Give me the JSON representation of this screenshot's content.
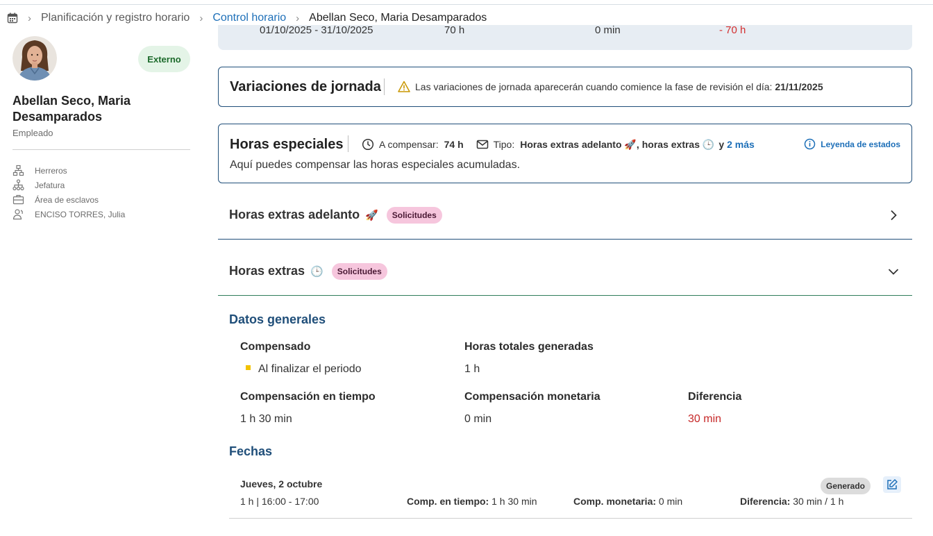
{
  "breadcrumb": {
    "items": [
      "Planificación y registro horario",
      "Control horario",
      "Abellan Seco, Maria Desamparados"
    ]
  },
  "employee": {
    "badge": "Externo",
    "name": "Abellan Seco, Maria Desamparados",
    "role": "Empleado",
    "details": [
      {
        "icon": "org-chart-icon",
        "text": "Herreros"
      },
      {
        "icon": "hierarchy-icon",
        "text": "Jefatura"
      },
      {
        "icon": "briefcase-icon",
        "text": "Área de esclavos"
      },
      {
        "icon": "person-manager-icon",
        "text": "ENCISO TORRES, Julia"
      }
    ]
  },
  "summary": {
    "period": "01/10/2025 - 31/10/2025",
    "hours": "70 h",
    "minutes": "0 min",
    "difference": "- 70 h"
  },
  "variaciones": {
    "title": "Variaciones de jornada",
    "notice_text": "Las variaciones de jornada aparecerán cuando comience la fase de revisión el día:",
    "notice_date": "21/11/2025"
  },
  "horas_especiales": {
    "title": "Horas especiales",
    "compensar_label": "A compensar:",
    "compensar_value": "74 h",
    "tipo_label": "Tipo:",
    "tipo_value_1": "Horas extras adelanto 🚀",
    "tipo_sep": ",",
    "tipo_value_2": "horas extras 🕒",
    "tipo_and": "y",
    "tipo_more": "2 más",
    "legend": "Leyenda de estados",
    "description": "Aquí puedes compensar las horas especiales acumuladas."
  },
  "accordions": [
    {
      "title": "Horas extras adelanto",
      "emoji": "🚀",
      "pill": "Solicitudes",
      "expanded": false
    },
    {
      "title": "Horas extras",
      "emoji": "🕒",
      "pill": "Solicitudes",
      "expanded": true
    }
  ],
  "datos_generales": {
    "title": "Datos generales",
    "compensado_label": "Compensado",
    "compensado_value": "Al finalizar el periodo",
    "horas_totales_label": "Horas totales generadas",
    "horas_totales_value": "1 h",
    "comp_tiempo_label": "Compensación en tiempo",
    "comp_tiempo_value": "1 h 30 min",
    "comp_monetaria_label": "Compensación monetaria",
    "comp_monetaria_value": "0 min",
    "diferencia_label": "Diferencia",
    "diferencia_value": "30 min"
  },
  "fechas": {
    "title": "Fechas",
    "rows": [
      {
        "day": "Jueves, 2 octubre",
        "status": "Generado",
        "time": "1 h | 16:00 - 17:00",
        "comp_tiempo_label": "Comp. en tiempo:",
        "comp_tiempo_value": "1 h 30 min",
        "comp_monetaria_label": "Comp. monetaria:",
        "comp_monetaria_value": "0 min",
        "diferencia_label": "Diferencia:",
        "diferencia_value": "30 min / 1 h"
      }
    ]
  },
  "colors": {
    "primary": "#1f4e79",
    "link": "#1d6fb8",
    "negative": "#c62828",
    "pill_pink": "#f6c6dd",
    "badge_green": "#e4f4e7"
  }
}
